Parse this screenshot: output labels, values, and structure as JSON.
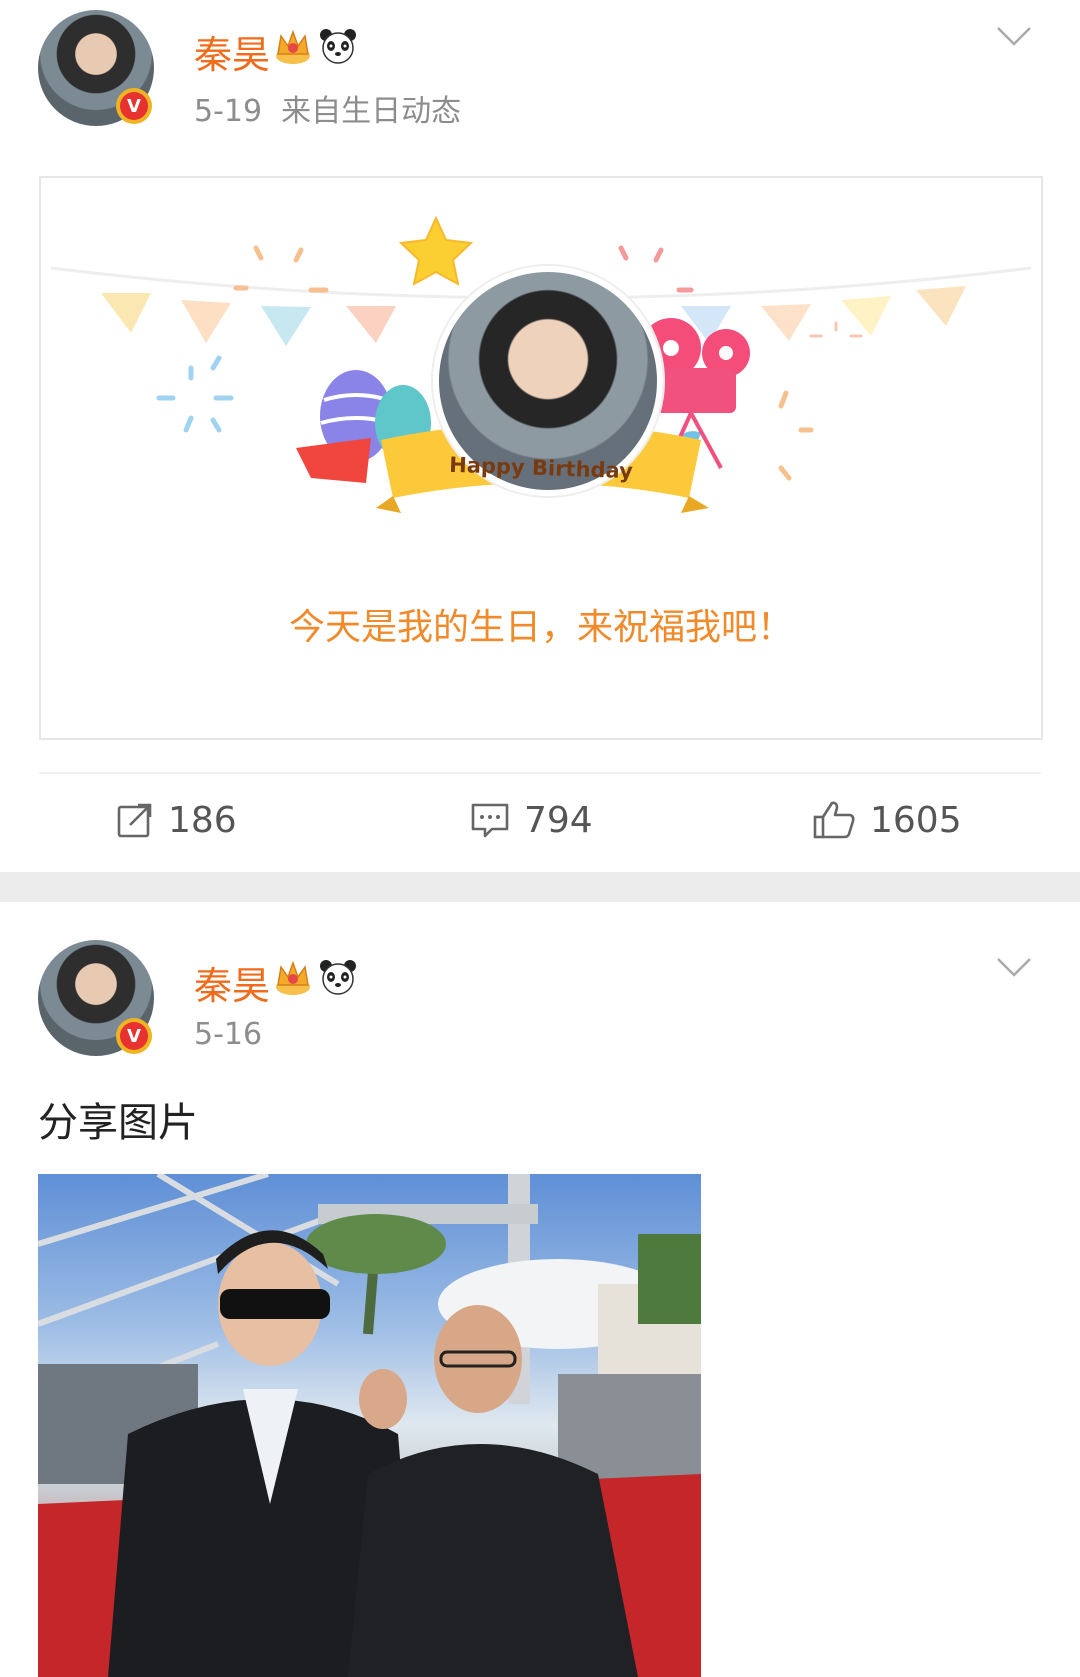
{
  "posts": [
    {
      "author": "秦昊",
      "date": "5-19",
      "source": "来自生日动态",
      "birthday_card": {
        "banner_text": "Happy Birthday",
        "message": "今天是我的生日，来祝福我吧！"
      },
      "actions": {
        "repost_count": "186",
        "comment_count": "794",
        "like_count": "1605"
      }
    },
    {
      "author": "秦昊",
      "date": "5-16",
      "text": "分享图片"
    }
  ],
  "colors": {
    "author_name": "#f06b1b",
    "birthday_message": "#f08a2a",
    "meta_text": "#8d8d8d",
    "verified_badge": "#e8322f",
    "separator": "#ececec"
  },
  "icons": {
    "membership": "crown-icon",
    "emoji": "panda-icon",
    "verified": "verified-badge-icon",
    "menu": "chevron-down-icon",
    "repost": "repost-icon",
    "comment": "comment-icon",
    "like": "like-icon"
  }
}
